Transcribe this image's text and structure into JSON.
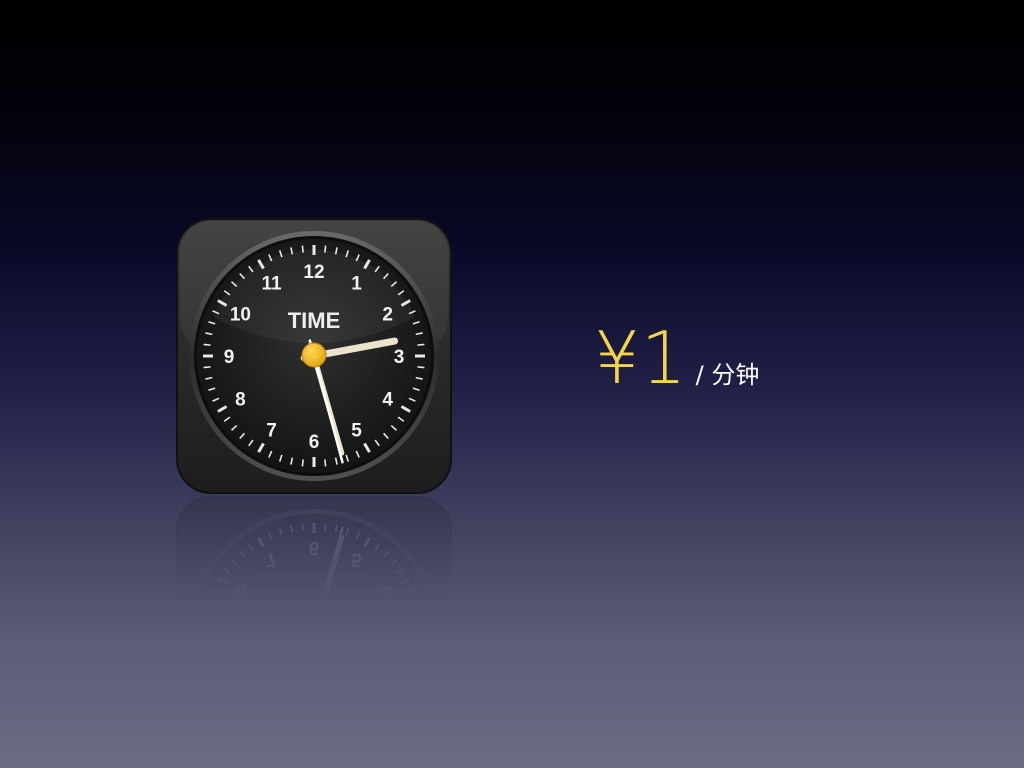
{
  "icon": {
    "name": "clock-icon",
    "brand_text": "TIME",
    "dial_numbers": [
      "12",
      "1",
      "2",
      "3",
      "4",
      "5",
      "6",
      "7",
      "8",
      "9",
      "10",
      "11"
    ],
    "shown_time": {
      "hour": 2,
      "minute": 27,
      "second": 27
    }
  },
  "price": {
    "amount": "¥1",
    "unit": "/ 分钟"
  },
  "colors": {
    "accent": "#f7d54a",
    "unit_text": "#ffffff",
    "bg_top": "#000000",
    "bg_bottom": "#6d6c86",
    "hand": "#ece3cc",
    "pivot": "#f3b61b"
  }
}
